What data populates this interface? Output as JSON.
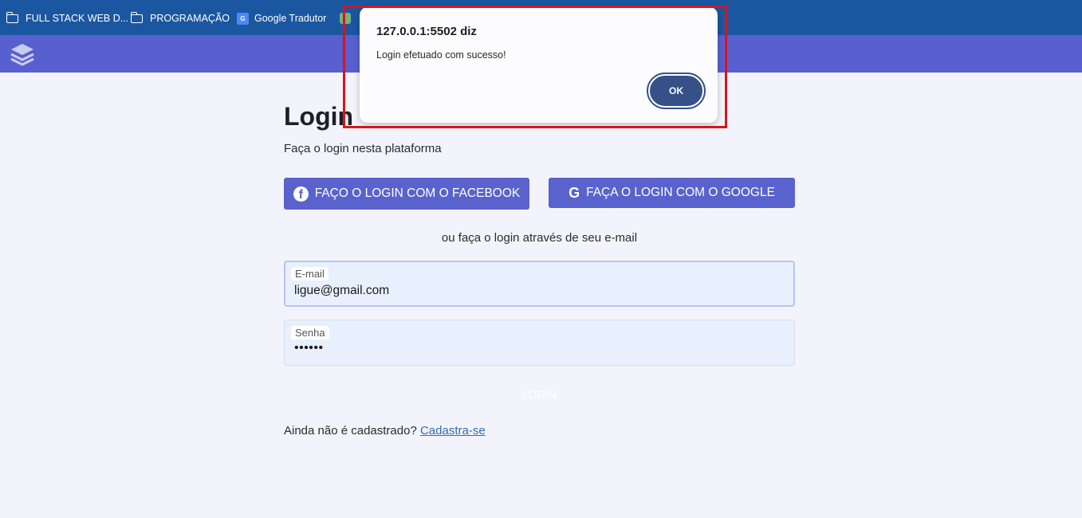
{
  "bookmarks": {
    "items": [
      {
        "label": "FULL STACK WEB D...",
        "icon": "folder-icon"
      },
      {
        "label": "PROGRAMAÇÃO",
        "icon": "folder-icon"
      },
      {
        "label": "Google Tradutor",
        "icon": "google-translate-icon"
      }
    ]
  },
  "header": {
    "logo_icon": "layers-icon",
    "background": "#5860cf"
  },
  "page": {
    "title": "Login",
    "subtitle": "Faça o login nesta plataforma",
    "facebook_button": "FAÇO O LOGIN COM O FACEBOOK",
    "google_button": "FAÇA O LOGIN COM O GOOGLE",
    "or_text": "ou faça o login através de seu e-mail",
    "email_label": "E-mail",
    "email_value": "ligue@gmail.com",
    "password_label": "Senha",
    "password_value": "••••••",
    "login_button": "LOGIN",
    "register_prompt": "Ainda não é cadastrado? ",
    "register_link": "Cadastra-se",
    "accent_color": "#5a62cd"
  },
  "dialog": {
    "origin": "127.0.0.1:5502 diz",
    "message": "Login efetuado com sucesso!",
    "ok_label": "OK",
    "highlight_color": "#d8141e"
  }
}
